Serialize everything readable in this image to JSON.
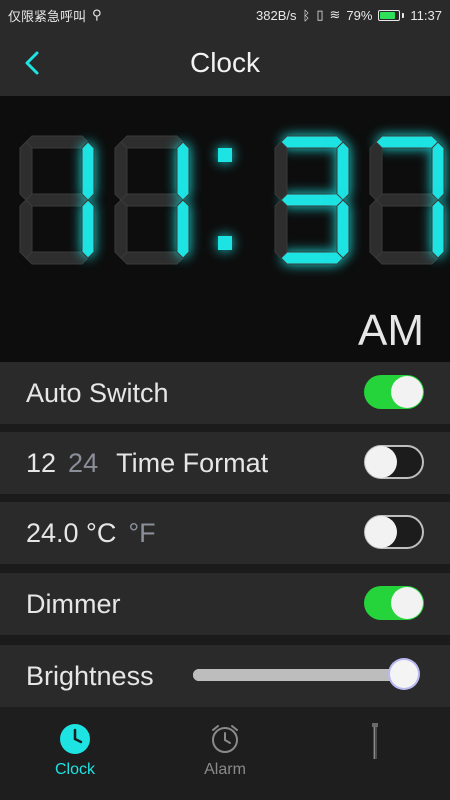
{
  "status": {
    "left_text": "仅限紧急呼叫",
    "net_speed": "382B/s",
    "battery": "79%",
    "battery_level": 0.79,
    "time": "11:37"
  },
  "header": {
    "title": "Clock"
  },
  "clock": {
    "digits": "11:37",
    "ampm": "AM",
    "digit_color": "#1de3e3",
    "dim_color": "#2e2e2e"
  },
  "settings": {
    "auto_switch": {
      "label": "Auto Switch",
      "on": true
    },
    "time_format": {
      "opt12": "12",
      "opt24": "24",
      "label": "Time Format",
      "on": false
    },
    "temp": {
      "celsius": "24.0 °C",
      "fahrenheit": "°F",
      "on": false
    },
    "dimmer": {
      "label": "Dimmer",
      "on": true
    },
    "brightness": {
      "label": "Brightness",
      "level": 0.95
    }
  },
  "nav": {
    "clock": {
      "label": "Clock",
      "color": "#1de3e3"
    },
    "alarm": {
      "label": "Alarm",
      "color": "#8a8a8a"
    }
  }
}
